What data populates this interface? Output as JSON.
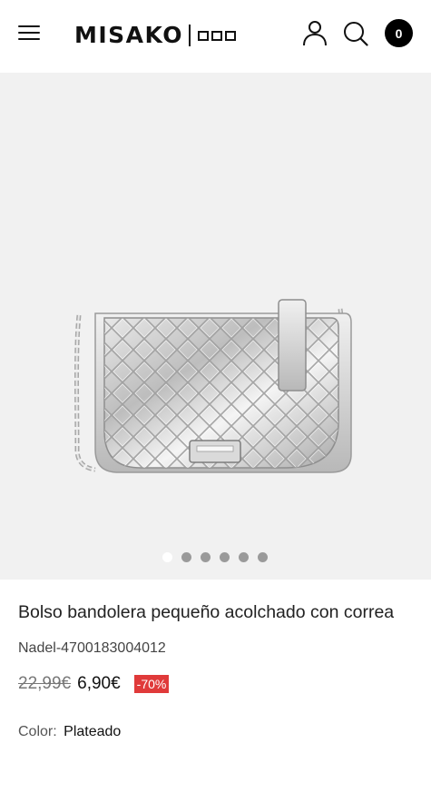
{
  "header": {
    "logo_text": "MISAKO",
    "cart_count": "0"
  },
  "gallery": {
    "slide_count": 6,
    "active_slide": 1
  },
  "product": {
    "title": "Bolso bandolera pequeño acolchado con correa",
    "brand": "Nadel",
    "separator": "-",
    "reference": "4700183004012",
    "old_price": "22,99€",
    "price": "6,90€",
    "discount": "-70%",
    "color_label": "Color:",
    "color_value": "Plateado"
  },
  "colors": {
    "discount_badge": "#e03a3a",
    "gallery_background": "#f1f1f1",
    "cart_badge": "#000000"
  },
  "icons": {
    "menu": "hamburger-icon",
    "account": "user-icon",
    "search": "search-icon",
    "cart": "cart-badge"
  }
}
